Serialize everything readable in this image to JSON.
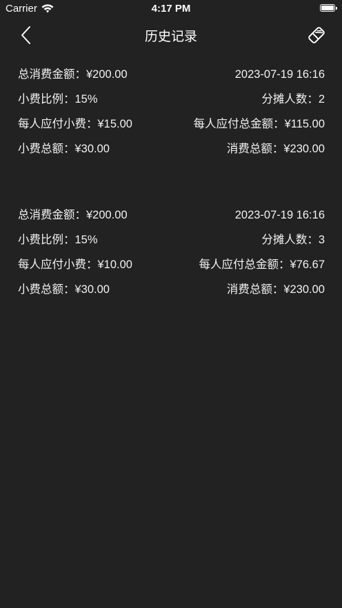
{
  "status_bar": {
    "carrier": "Carrier",
    "time": "4:17 PM",
    "battery_level": 1.0
  },
  "nav": {
    "title": "历史记录",
    "back_icon": "chevron-left-icon",
    "clear_icon": "eraser-icon"
  },
  "records": [
    {
      "total_amount": "总消费金额：¥200.00",
      "datetime": "2023-07-19 16:16",
      "tip_rate": "小费比例：15%",
      "people": "分摊人数：2",
      "tip_per_person": "每人应付小费：¥15.00",
      "total_per_person": "每人应付总金额：¥115.00",
      "tip_total": "小费总额：¥30.00",
      "grand_total": "消费总额：¥230.00"
    },
    {
      "total_amount": "总消费金额：¥200.00",
      "datetime": "2023-07-19 16:16",
      "tip_rate": "小费比例：15%",
      "people": "分摊人数：3",
      "tip_per_person": "每人应付小费：¥10.00",
      "total_per_person": "每人应付总金额：¥76.67",
      "tip_total": "小费总额：¥30.00",
      "grand_total": "消费总额：¥230.00"
    }
  ]
}
